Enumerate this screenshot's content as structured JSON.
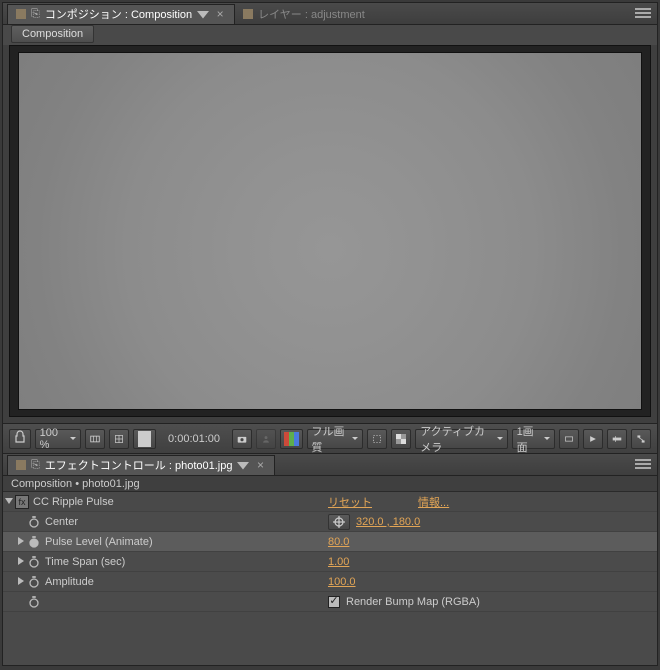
{
  "viewer": {
    "tabs": [
      {
        "label": "コンポジション : Composition",
        "active": true
      },
      {
        "label": "レイヤー : adjustment",
        "active": false
      }
    ],
    "breadcrumb": "Composition"
  },
  "footer": {
    "zoom": "100 %",
    "time": "0:00:01:00",
    "quality": "フル画質",
    "camera": "アクティブカメラ",
    "view": "1画面"
  },
  "fx": {
    "tab_label": "エフェクトコントロール : photo01.jpg",
    "breadcrumb": "Composition • photo01.jpg",
    "effect_name": "CC Ripple Pulse",
    "reset_label": "リセット",
    "info_label": "情報...",
    "props": {
      "center": {
        "label": "Center",
        "value": "320.0 , 180.0"
      },
      "pulse": {
        "label": "Pulse Level (Animate)",
        "value": "80.0"
      },
      "time": {
        "label": "Time Span (sec)",
        "value": "1.00"
      },
      "amp": {
        "label": "Amplitude",
        "value": "100.0"
      },
      "bump": {
        "label": "Render Bump Map (RGBA)"
      }
    }
  }
}
